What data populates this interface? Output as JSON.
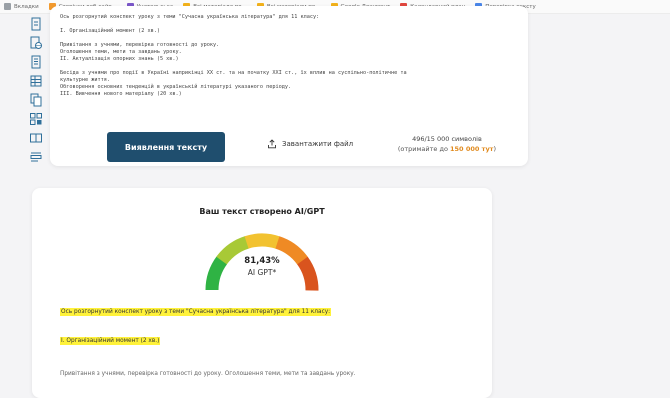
{
  "bookmarks": [
    {
      "label": "Вкладки",
      "color": "#9aa0a6"
    },
    {
      "label": "Сторінки веб-сайт...",
      "color": "#f29a2e"
    },
    {
      "label": "Учительська",
      "color": "#7b57c9"
    },
    {
      "label": "Всі матеріали по...",
      "color": "#f2b21c"
    },
    {
      "label": "Всі матеріали по...",
      "color": "#f2b21c"
    },
    {
      "label": "Google Документ",
      "color": "#f2b21c"
    },
    {
      "label": "Календарний план",
      "color": "#e1473f"
    },
    {
      "label": "Перевірка тексту",
      "color": "#4a86e8"
    }
  ],
  "tools": [
    {
      "name": "document-icon"
    },
    {
      "name": "globe-document-icon"
    },
    {
      "name": "list-document-icon"
    },
    {
      "name": "table-document-icon"
    },
    {
      "name": "copy-document-icon"
    },
    {
      "name": "grid-scan-icon"
    },
    {
      "name": "book-icon"
    },
    {
      "name": "form-icon"
    }
  ],
  "editor": {
    "text": "Ось розгорнутий конспект уроку з теми \"Сучасна українська література\" для 11 класу:\n\nI. Організаційний момент (2 хв.)\n\nПривітання з учнями, перевірка готовності до уроку.\nОголошення теми, мети та завдань уроку.\nII. Актуалізація опорних знань (5 хв.)\n\nБесіда з учнями про події в Україні наприкінці XX ст. та на початку XXI ст., їх вплив на суспільно-політичне та\nкультурне життя.\nОбговорення основних тенденцій в українській літературі указаного періоду.\nIII. Вивчення нового матеріалу (20 хв.)"
  },
  "actions": {
    "scan_label": "Виявлення тексту",
    "upload_label": "Завантажити файл"
  },
  "counter": {
    "count": "496/15 000 символів",
    "bonus_prefix": "(отримайте до",
    "bonus_value": "150 000 тут",
    "bonus_suffix": ")"
  },
  "result": {
    "title": "Ваш текст створено AI/GPT",
    "percent": "81,43%",
    "percent_value": 81.43,
    "label": "AI GPT*",
    "gauge_colors": [
      "#2fb344",
      "#a8c936",
      "#f2c230",
      "#ef8a24",
      "#d9541e"
    ],
    "lines": [
      {
        "text": "Ось розгорнутий конспект уроку з теми \"Сучасна українська література\" для 11 класу:",
        "highlight": true
      },
      {
        "text": "I. Організаційний момент (2 хв.)",
        "highlight": true
      },
      {
        "text": "Привітання з учнями, перевірка готовності до уроку. Оголошення теми, мети та завдань уроку.",
        "highlight": false
      }
    ]
  }
}
